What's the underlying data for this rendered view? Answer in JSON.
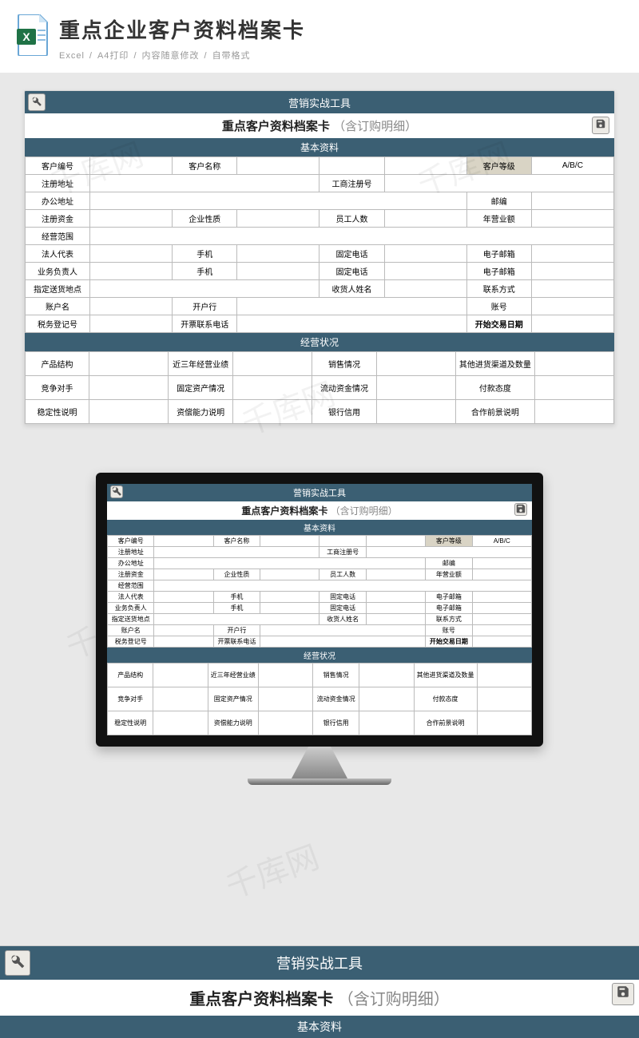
{
  "page": {
    "main_title": "重点企业客户资料档案卡",
    "subtitle_parts": [
      "Excel",
      "A4打印",
      "内容随意修改",
      "自带格式"
    ]
  },
  "sheet": {
    "toolbar_title": "营销实战工具",
    "doc_title": "重点客户资料档案卡",
    "doc_title_sub": "（含订购明细）",
    "section1": "基本资料",
    "section2": "经营状况",
    "labels": {
      "customer_no": "客户编号",
      "customer_name": "客户名称",
      "customer_level": "客户等级",
      "level_options": "A/B/C",
      "reg_addr": "注册地址",
      "biz_reg_no": "工商注册号",
      "office_addr": "办公地址",
      "postcode": "邮编",
      "reg_capital": "注册资金",
      "enterprise_nature": "企业性质",
      "employee_count": "员工人数",
      "annual_turnover": "年营业额",
      "business_scope": "经营范围",
      "legal_rep": "法人代表",
      "mobile": "手机",
      "fixed_phone": "固定电话",
      "email": "电子邮箱",
      "biz_owner": "业务负责人",
      "delivery_addr": "指定送货地点",
      "receiver_name": "收货人姓名",
      "contact_method": "联系方式",
      "account_name": "账户名",
      "bank": "开户行",
      "account_no": "账号",
      "tax_reg_no": "税务登记号",
      "invoice_contact": "开票联系电话",
      "trade_start_date": "开始交易日期",
      "product_structure": "产品结构",
      "recent3_performance": "近三年经营业绩",
      "sales_status": "销售情况",
      "other_channels": "其他进货渠道及数量",
      "competitors": "竞争对手",
      "fixed_assets": "固定资产情况",
      "liquid_assets": "流动资金情况",
      "payment_attitude": "付款态度",
      "stability_desc": "稳定性说明",
      "debt_capacity": "资偿能力说明",
      "bank_credit": "银行信用",
      "coop_prospect": "合作前景说明"
    }
  },
  "watermark": "千库网"
}
